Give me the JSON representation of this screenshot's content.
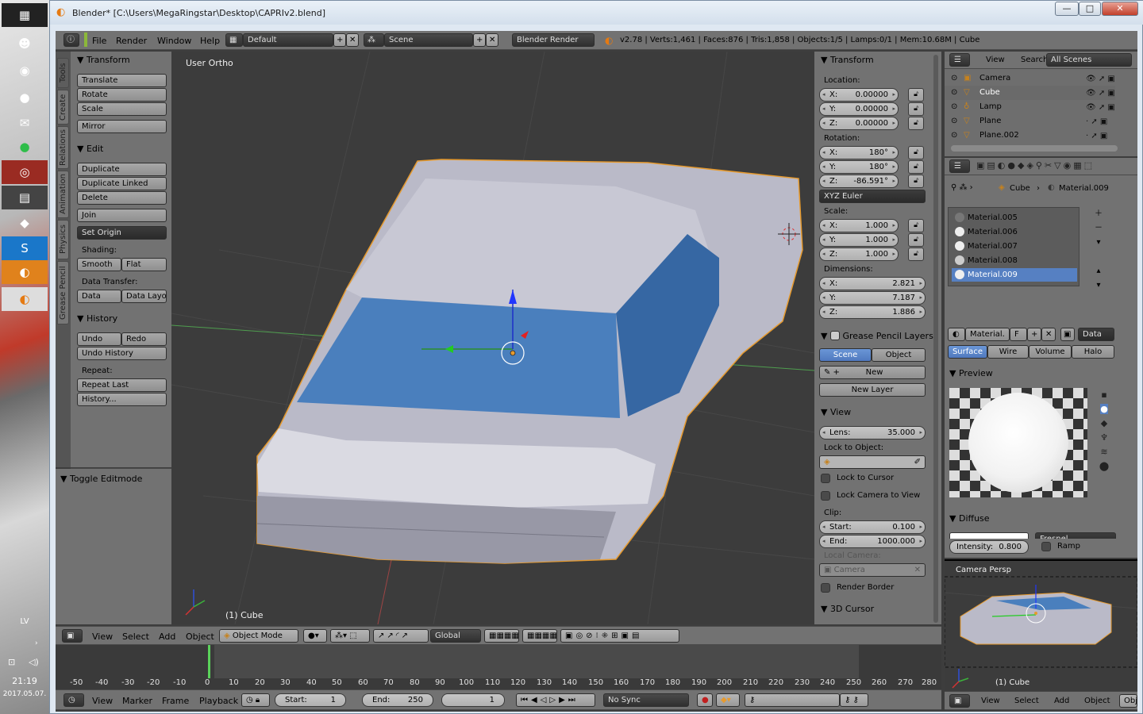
{
  "window": {
    "title": "Blender* [C:\\Users\\MegaRingstar\\Desktop\\CAPRIv2.blend]",
    "btn_min": "—",
    "btn_max": "□",
    "btn_close": "✕"
  },
  "taskbar": {
    "lang": "LV",
    "time": "21:19",
    "date": "2017.05.07."
  },
  "topbar": {
    "menu_file": "File",
    "menu_render": "Render",
    "menu_window": "Window",
    "menu_help": "Help",
    "layout": "Default",
    "scene": "Scene",
    "engine": "Blender Render",
    "stats": "v2.78 | Verts:1,461 | Faces:876 | Tris:1,858 | Objects:1/5 | Lamps:0/1 | Mem:10.68M | Cube"
  },
  "tool_tabs": {
    "tools": "Tools",
    "create": "Create",
    "relations": "Relations",
    "animation": "Animation",
    "physics": "Physics",
    "grease": "Grease Pencil"
  },
  "tools": {
    "transform_title": "Transform",
    "translate": "Translate",
    "rotate": "Rotate",
    "scale": "Scale",
    "mirror": "Mirror",
    "edit_title": "Edit",
    "duplicate": "Duplicate",
    "duplicate_linked": "Duplicate Linked",
    "delete": "Delete",
    "join": "Join",
    "set_origin": "Set Origin",
    "shading_label": "Shading:",
    "smooth": "Smooth",
    "flat": "Flat",
    "data_transfer_label": "Data Transfer:",
    "data": "Data",
    "data_layo": "Data Layo",
    "history_title": "History",
    "undo": "Undo",
    "redo": "Redo",
    "undo_history": "Undo History",
    "repeat_label": "Repeat:",
    "repeat_last": "Repeat Last",
    "history_dots": "History...",
    "toggle_editmode": "Toggle Editmode"
  },
  "viewport": {
    "view_label": "User Ortho",
    "object_label": "(1) Cube"
  },
  "props": {
    "transform_title": "Transform",
    "location_label": "Location:",
    "loc": [
      {
        "k": "X:",
        "v": "0.00000"
      },
      {
        "k": "Y:",
        "v": "0.00000"
      },
      {
        "k": "Z:",
        "v": "0.00000"
      }
    ],
    "rotation_label": "Rotation:",
    "rot": [
      {
        "k": "X:",
        "v": "180°"
      },
      {
        "k": "Y:",
        "v": "180°"
      },
      {
        "k": "Z:",
        "v": "-86.591°"
      }
    ],
    "euler": "XYZ Euler",
    "scale_label": "Scale:",
    "scl": [
      {
        "k": "X:",
        "v": "1.000"
      },
      {
        "k": "Y:",
        "v": "1.000"
      },
      {
        "k": "Z:",
        "v": "1.000"
      }
    ],
    "dimensions_label": "Dimensions:",
    "dim": [
      {
        "k": "X:",
        "v": "2.821"
      },
      {
        "k": "Y:",
        "v": "7.187"
      },
      {
        "k": "Z:",
        "v": "1.886"
      }
    ],
    "gp_title": "Grease Pencil Layers",
    "gp_scene": "Scene",
    "gp_object": "Object",
    "gp_new": "New",
    "gp_new_layer": "New Layer",
    "view_title": "View",
    "lens_k": "Lens:",
    "lens_v": "35.000",
    "lock_obj_label": "Lock to Object:",
    "lock_cursor": "Lock to Cursor",
    "lock_camera": "Lock Camera to View",
    "clip_label": "Clip:",
    "clip_start_k": "Start:",
    "clip_start_v": "0.100",
    "clip_end_k": "End:",
    "clip_end_v": "1000.000",
    "local_camera_label": "Local Camera:",
    "camera_field": "Camera",
    "render_border": "Render Border",
    "cursor_title": "3D Cursor"
  },
  "outliner": {
    "view": "View",
    "search": "Search",
    "all_scenes": "All Scenes",
    "items": [
      {
        "name": "Camera"
      },
      {
        "name": "Cube"
      },
      {
        "name": "Lamp"
      },
      {
        "name": "Plane"
      },
      {
        "name": "Plane.002"
      }
    ]
  },
  "material": {
    "breadcrumb_obj": "Cube",
    "breadcrumb_mat": "Material.009",
    "slots": [
      "Material.005",
      "Material.006",
      "Material.007",
      "Material.008",
      "Material.009"
    ],
    "mat_field": "Material.",
    "f_btn": "F",
    "data_dd": "Data",
    "tabs": {
      "surface": "Surface",
      "wire": "Wire",
      "volume": "Volume",
      "halo": "Halo"
    },
    "preview_title": "Preview",
    "diffuse_title": "Diffuse",
    "fresnel": "Fresnel",
    "intensity_k": "Intensity:",
    "intensity_v": "0.800",
    "ramp": "Ramp"
  },
  "camera_view": {
    "label": "Camera Persp",
    "object_label": "(1) Cube",
    "menu_view": "View",
    "menu_select": "Select",
    "menu_add": "Add",
    "menu_object": "Object",
    "mode": "Obj"
  },
  "viewport_header": {
    "view": "View",
    "select": "Select",
    "add": "Add",
    "object": "Object",
    "mode": "Object Mode",
    "orientation": "Global"
  },
  "timeline": {
    "ticks": [
      "-50",
      "-40",
      "-30",
      "-20",
      "-10",
      "0",
      "10",
      "20",
      "30",
      "40",
      "50",
      "60",
      "70",
      "80",
      "90",
      "100",
      "110",
      "120",
      "130",
      "140",
      "150",
      "160",
      "170",
      "180",
      "190",
      "200",
      "210",
      "220",
      "230",
      "240",
      "250",
      "260",
      "270",
      "280"
    ],
    "view": "View",
    "marker": "Marker",
    "frame": "Frame",
    "playback": "Playback",
    "start_k": "Start:",
    "start_v": "1",
    "end_k": "End:",
    "end_v": "250",
    "current": "1",
    "sync": "No Sync"
  }
}
